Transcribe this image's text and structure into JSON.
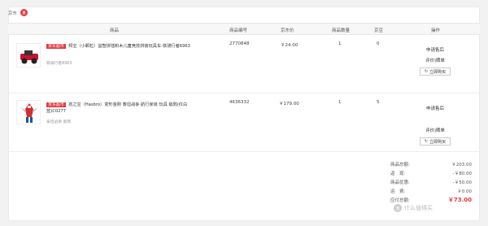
{
  "shop": {
    "name": "京东",
    "logo_text": "京"
  },
  "header": {
    "product": "商品",
    "sku": "商品编号",
    "price": "京东价",
    "qty": "商品数量",
    "jd_bean": "京豆",
    "ops": "操作"
  },
  "badge_label": "京东超市",
  "items": [
    {
      "title": "邦宝（小颗粒）益智拼插积木儿童竞技拼装玩具车-铁骑行者6963",
      "sub": "铁骑行者6963",
      "sku": "2770848",
      "price": "￥24.00",
      "qty": "1",
      "bean": "0",
      "after_sale": "申请售后",
      "review": "评价|晒单",
      "rebuy": "立即购买"
    },
    {
      "title": "孩之宝（Hasbro）变形金刚 泰坦战争 航行家级 玩具 敌鸦(红白蓝)C0277",
      "sub": "泰坦战争 敌鸦",
      "sku": "4636332",
      "price": "￥179.00",
      "qty": "1",
      "bean": "5",
      "after_sale": "申请售后",
      "review": "评价|晒单",
      "rebuy": "立即购买"
    }
  ],
  "summary": [
    {
      "label": "商品总额:",
      "value": "￥203.00"
    },
    {
      "label": "返　现:",
      "value": "-￥80.00"
    },
    {
      "label": "商品优惠:",
      "value": "-￥50.00"
    },
    {
      "label": "运　费:",
      "value": "￥0.00"
    },
    {
      "label": "应付总额:",
      "value": "￥73.00"
    }
  ],
  "watermark": {
    "text": "什么值得买",
    "icon": "值"
  },
  "colors": {
    "accent": "#e4393c",
    "header_bg": "#f7f7f7"
  }
}
